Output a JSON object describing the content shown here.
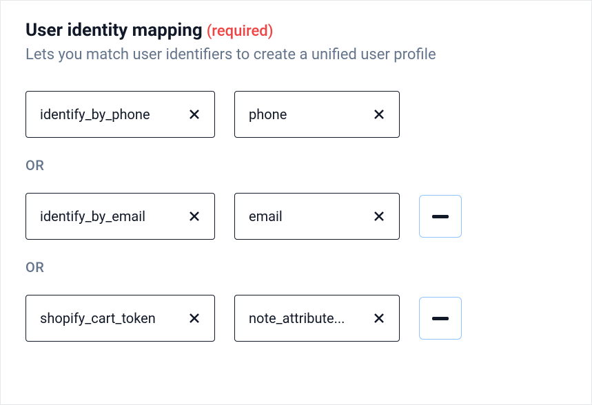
{
  "heading": "User identity mapping",
  "required_label": "(required)",
  "subtitle": "Lets you match user identifiers to create a unified user profile",
  "or_label": "OR",
  "rows": [
    {
      "left": "identify_by_phone",
      "right": "phone"
    },
    {
      "left": "identify_by_email",
      "right": "email"
    },
    {
      "left": "shopify_cart_token",
      "right": "note_attribute..."
    }
  ]
}
